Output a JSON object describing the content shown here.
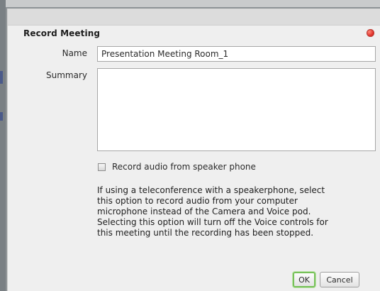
{
  "dialog": {
    "title": "Record Meeting",
    "close_icon": "close-icon",
    "close_color": "#e0312a"
  },
  "form": {
    "name_label": "Name",
    "name_value": "Presentation Meeting Room_1",
    "summary_label": "Summary",
    "summary_value": "",
    "checkbox_label": "Record audio from speaker phone",
    "checkbox_checked": false,
    "help_lines": [
      "If using a teleconference with a speakerphone, select",
      "this option to record audio from your computer",
      "microphone instead of the Camera and Voice pod.",
      "Selecting this option will turn off the Voice controls for",
      "this meeting until the recording has been stopped."
    ]
  },
  "buttons": {
    "ok_label": "OK",
    "cancel_label": "Cancel",
    "ok_focus_color": "#77c159"
  }
}
